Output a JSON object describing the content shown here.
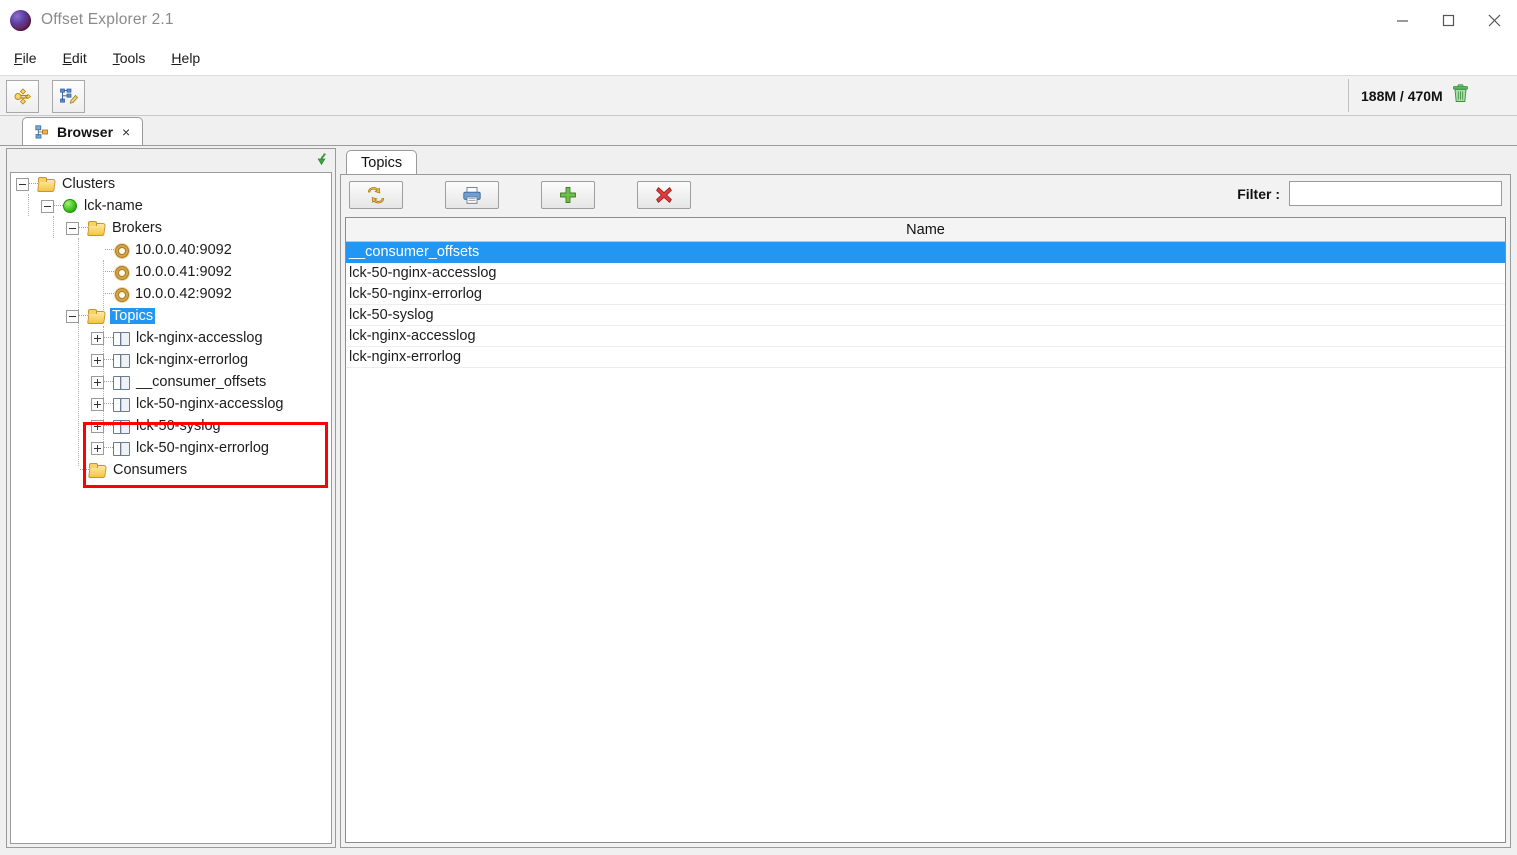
{
  "window": {
    "title": "Offset Explorer  2.1",
    "app_icon": "sphere-icon",
    "minimize": "minimize-icon",
    "maximize": "maximize-icon",
    "close": "close-icon"
  },
  "menubar": {
    "items": [
      {
        "label": "File",
        "mnemonic": "F"
      },
      {
        "label": "Edit",
        "mnemonic": "E"
      },
      {
        "label": "Tools",
        "mnemonic": "T"
      },
      {
        "label": "Help",
        "mnemonic": "H"
      }
    ]
  },
  "toolbar": {
    "buttons": [
      {
        "name": "add-cluster-button",
        "icon": "connection-icon"
      },
      {
        "name": "edit-cluster-button",
        "icon": "tree-edit-icon"
      }
    ],
    "memory": {
      "used": "188M",
      "separator": " / ",
      "total": "470M",
      "full_text": "188M / 470M",
      "gc_icon": "trash-icon"
    }
  },
  "tabstrip": {
    "tabs": [
      {
        "label": "Browser",
        "icon": "hierarchy-icon",
        "close": "×",
        "active": true
      }
    ]
  },
  "left_panel": {
    "collapse_icon": "green-down-arrow-icon",
    "tree": [
      {
        "label": "Clusters",
        "depth": 0,
        "icon": "folder-icon",
        "expander": "minus",
        "selected": false
      },
      {
        "label": "lck-name",
        "depth": 1,
        "icon": "status-dot-icon",
        "expander": "minus",
        "selected": false
      },
      {
        "label": "Brokers",
        "depth": 2,
        "icon": "folder-icon",
        "expander": "minus",
        "selected": false
      },
      {
        "label": "10.0.0.40:9092",
        "depth": 3,
        "icon": "gear-icon",
        "expander": "none",
        "selected": false
      },
      {
        "label": "10.0.0.41:9092",
        "depth": 3,
        "icon": "gear-icon",
        "expander": "none",
        "selected": false
      },
      {
        "label": "10.0.0.42:9092",
        "depth": 3,
        "icon": "gear-icon",
        "expander": "none",
        "selected": false
      },
      {
        "label": "Topics",
        "depth": 2,
        "icon": "folder-icon",
        "expander": "minus",
        "selected": true
      },
      {
        "label": "lck-nginx-accesslog",
        "depth": 3,
        "icon": "topic-icon",
        "expander": "plus",
        "selected": false
      },
      {
        "label": "lck-nginx-errorlog",
        "depth": 3,
        "icon": "topic-icon",
        "expander": "plus",
        "selected": false
      },
      {
        "label": "__consumer_offsets",
        "depth": 3,
        "icon": "topic-icon",
        "expander": "plus",
        "selected": false
      },
      {
        "label": "lck-50-nginx-accesslog",
        "depth": 3,
        "icon": "topic-icon",
        "expander": "plus",
        "selected": false
      },
      {
        "label": "lck-50-syslog",
        "depth": 3,
        "icon": "topic-icon",
        "expander": "plus",
        "selected": false
      },
      {
        "label": "lck-50-nginx-errorlog",
        "depth": 3,
        "icon": "topic-icon",
        "expander": "plus",
        "selected": false
      },
      {
        "label": "Consumers",
        "depth": 2,
        "icon": "folder-icon",
        "expander": "none",
        "selected": false
      }
    ],
    "annotation": {
      "type": "red-highlight-box",
      "color": "#ff0000",
      "covers_rows": [
        10,
        11,
        12
      ]
    }
  },
  "right_panel": {
    "tabs": [
      {
        "label": "Topics",
        "active": true
      }
    ],
    "toolbar_buttons": [
      {
        "name": "refresh-button",
        "icon": "refresh-icon"
      },
      {
        "name": "print-button",
        "icon": "printer-icon"
      },
      {
        "name": "add-topic-button",
        "icon": "plus-icon"
      },
      {
        "name": "delete-topic-button",
        "icon": "red-x-icon"
      }
    ],
    "filter": {
      "label": "Filter :",
      "value": "",
      "placeholder": ""
    },
    "table": {
      "columns": [
        "Name"
      ],
      "rows": [
        {
          "Name": "__consumer_offsets",
          "selected": true
        },
        {
          "Name": "lck-50-nginx-accesslog",
          "selected": false
        },
        {
          "Name": "lck-50-nginx-errorlog",
          "selected": false
        },
        {
          "Name": "lck-50-syslog",
          "selected": false
        },
        {
          "Name": "lck-nginx-accesslog",
          "selected": false
        },
        {
          "Name": "lck-nginx-errorlog",
          "selected": false
        }
      ]
    }
  },
  "colors": {
    "selection_blue": "#2196f3",
    "annotation_red": "#ff0000",
    "status_green": "#36c118",
    "panel_gray": "#f0f0f0"
  }
}
